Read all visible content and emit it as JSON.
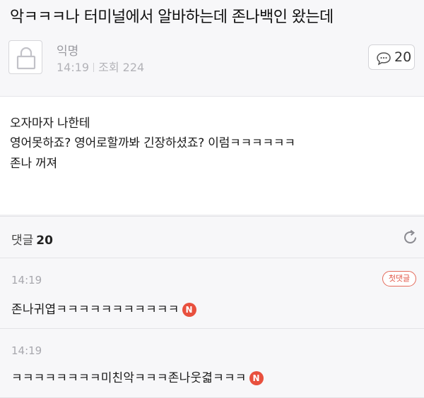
{
  "post": {
    "title": "악ㅋㅋㅋ나 터미널에서 알바하는데 존나백인 왔는데",
    "author": "익명",
    "time": "14:19",
    "views_label": "조회",
    "views": "224",
    "comment_count": "20"
  },
  "body": {
    "lines": [
      "오자마자 나한테",
      "영어못하죠? 영어로할까봐 긴장하셨죠? 이럼ㅋㅋㅋㅋㅋㅋ",
      "존나 꺼져"
    ]
  },
  "comments_section": {
    "label": "댓글",
    "count": "20"
  },
  "comments": [
    {
      "time": "14:19",
      "text": "존나귀엽ㅋㅋㅋㅋㅋㅋㅋㅋㅋㅋㅋ",
      "badge": "첫댓글",
      "new_badge": "N"
    },
    {
      "time": "14:19",
      "text": "ㅋㅋㅋㅋㅋㅋㅋㅋ미친악ㅋㅋㅋ존나웃겳ㅋㅋㅋ",
      "new_badge": "N"
    }
  ],
  "colors": {
    "badge_red": "#e8503e",
    "header_bg": "#f7f7f9",
    "body_bg": "#ffffff"
  },
  "icons": {
    "avatar": "anonymous-lock-icon",
    "comment": "speech-bubble-icon",
    "refresh": "refresh-icon"
  }
}
